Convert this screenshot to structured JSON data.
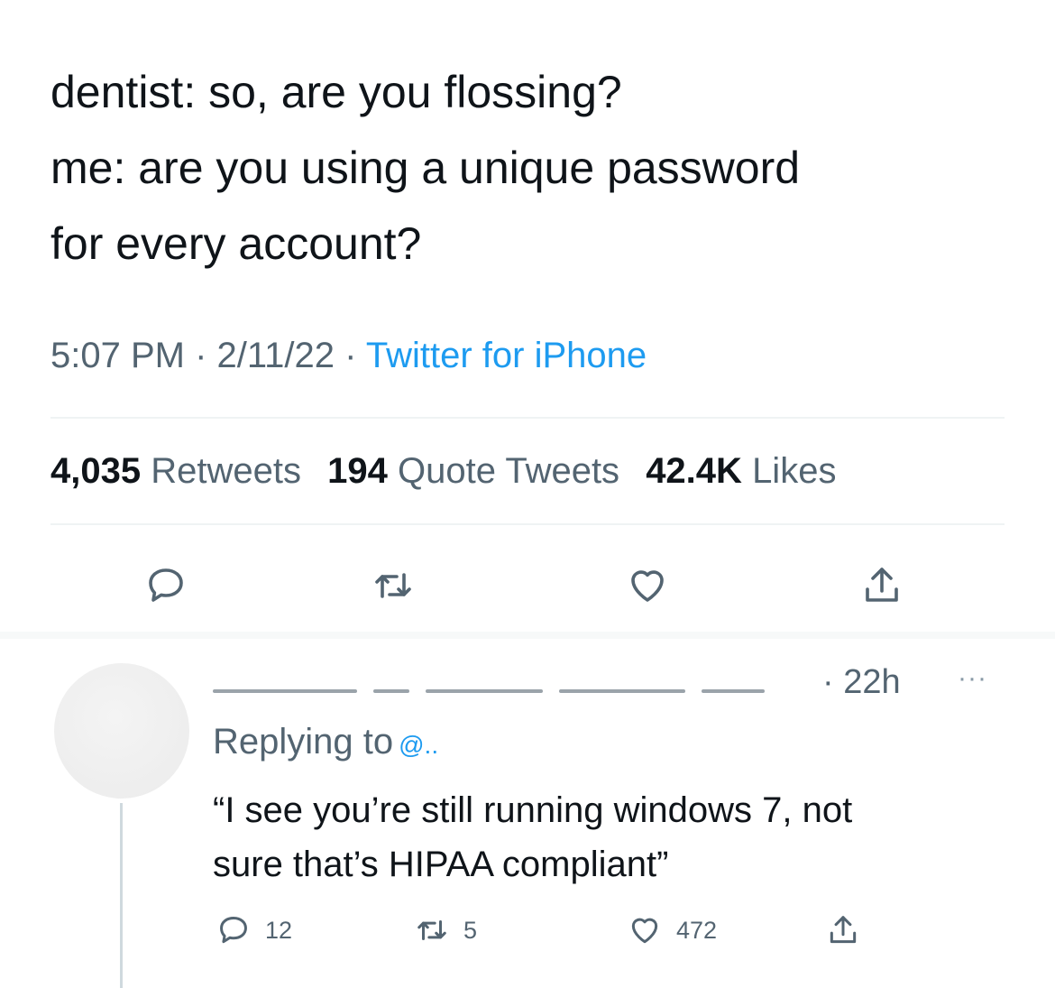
{
  "tweet": {
    "lines": [
      "dentist: so, are you flossing?",
      "me: are you using a unique password",
      "for every account?"
    ],
    "time": "5:07 PM",
    "date": "2/11/22",
    "source": "Twitter for iPhone",
    "separator": "·"
  },
  "stats": {
    "retweets_count": "4,035",
    "retweets_label": "Retweets",
    "quotes_count": "194",
    "quotes_label": "Quote Tweets",
    "likes_count": "42.4K",
    "likes_label": "Likes"
  },
  "actions": {
    "icons": [
      "reply-icon",
      "retweet-icon",
      "like-icon",
      "share-icon"
    ],
    "colors": {
      "icon": "#536471",
      "accent": "#1d9bf0"
    }
  },
  "reply": {
    "time": "· 22h",
    "more": "···",
    "replying_label": "Replying to",
    "handle_fragment": "@..",
    "lines": [
      "“I see you’re still running windows 7, not",
      "sure that’s HIPAA compliant”"
    ],
    "replies": "12",
    "retweets": "5",
    "likes": "472"
  }
}
